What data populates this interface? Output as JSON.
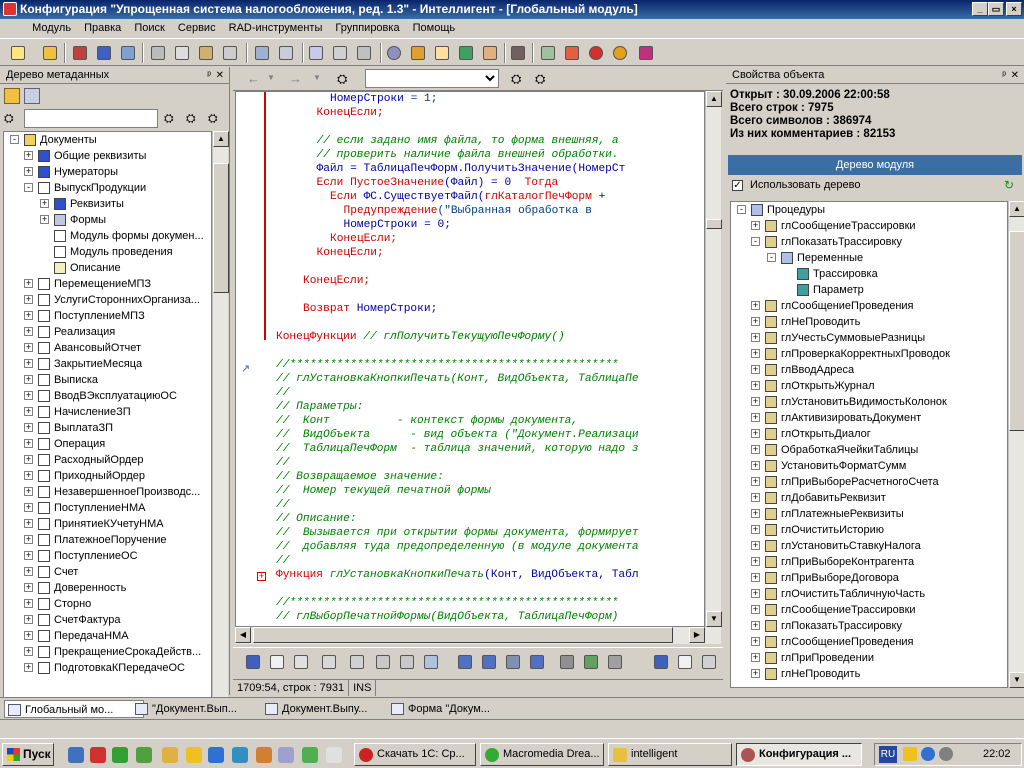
{
  "window": {
    "title": "Конфигурация \"Упрощенная система налогообложения, ред. 1.3\" - Интеллигент - [Глобальный модуль]"
  },
  "menu": [
    "Модуль",
    "Правка",
    "Поиск",
    "Сервис",
    "RAD-инструменты",
    "Группировка",
    "Помощь"
  ],
  "left_panel": {
    "title": "Дерево метаданных",
    "root": "Документы",
    "items": [
      {
        "label": "Общие реквизиты",
        "level": 1,
        "exp": "+",
        "icon": "attr"
      },
      {
        "label": "Нумераторы",
        "level": 1,
        "exp": "+",
        "icon": "attr"
      },
      {
        "label": "ВыпускПродукции",
        "level": 1,
        "exp": "-",
        "icon": "doc"
      },
      {
        "label": "Реквизиты",
        "level": 2,
        "exp": "+",
        "icon": "attr"
      },
      {
        "label": "Формы",
        "level": 2,
        "exp": "+",
        "icon": "form"
      },
      {
        "label": "Модуль формы докумен...",
        "level": 2,
        "exp": "",
        "icon": "doc"
      },
      {
        "label": "Модуль проведения",
        "level": 2,
        "exp": "",
        "icon": "doc"
      },
      {
        "label": "Описание",
        "level": 2,
        "exp": "",
        "icon": "desc"
      },
      {
        "label": "ПеремещениеМПЗ",
        "level": 1,
        "exp": "+",
        "icon": "doc"
      },
      {
        "label": "УслугиСтороннихОрганиза...",
        "level": 1,
        "exp": "+",
        "icon": "doc"
      },
      {
        "label": "ПоступлениеМПЗ",
        "level": 1,
        "exp": "+",
        "icon": "doc"
      },
      {
        "label": "Реализация",
        "level": 1,
        "exp": "+",
        "icon": "doc"
      },
      {
        "label": "АвансовыйОтчет",
        "level": 1,
        "exp": "+",
        "icon": "doc"
      },
      {
        "label": "ЗакрытиеМесяца",
        "level": 1,
        "exp": "+",
        "icon": "doc"
      },
      {
        "label": "Выписка",
        "level": 1,
        "exp": "+",
        "icon": "doc"
      },
      {
        "label": "ВводВЭксплуатациюОС",
        "level": 1,
        "exp": "+",
        "icon": "doc"
      },
      {
        "label": "НачислениеЗП",
        "level": 1,
        "exp": "+",
        "icon": "doc"
      },
      {
        "label": "ВыплатаЗП",
        "level": 1,
        "exp": "+",
        "icon": "doc"
      },
      {
        "label": "Операция",
        "level": 1,
        "exp": "+",
        "icon": "doc"
      },
      {
        "label": "РасходныйОрдер",
        "level": 1,
        "exp": "+",
        "icon": "doc"
      },
      {
        "label": "ПриходныйОрдер",
        "level": 1,
        "exp": "+",
        "icon": "doc"
      },
      {
        "label": "НезавершенноеПроизводс...",
        "level": 1,
        "exp": "+",
        "icon": "doc"
      },
      {
        "label": "ПоступлениеНМА",
        "level": 1,
        "exp": "+",
        "icon": "doc"
      },
      {
        "label": "ПринятиеКУчетуНМА",
        "level": 1,
        "exp": "+",
        "icon": "doc"
      },
      {
        "label": "ПлатежноеПоручение",
        "level": 1,
        "exp": "+",
        "icon": "doc"
      },
      {
        "label": "ПоступлениеОС",
        "level": 1,
        "exp": "+",
        "icon": "doc"
      },
      {
        "label": "Счет",
        "level": 1,
        "exp": "+",
        "icon": "doc"
      },
      {
        "label": "Доверенность",
        "level": 1,
        "exp": "+",
        "icon": "doc"
      },
      {
        "label": "Сторно",
        "level": 1,
        "exp": "+",
        "icon": "doc"
      },
      {
        "label": "СчетФактура",
        "level": 1,
        "exp": "+",
        "icon": "doc"
      },
      {
        "label": "ПередачаНМА",
        "level": 1,
        "exp": "+",
        "icon": "doc"
      },
      {
        "label": "ПрекращениеСрокаДейств...",
        "level": 1,
        "exp": "+",
        "icon": "doc"
      },
      {
        "label": "ПодготовкаКПередачеОС",
        "level": 1,
        "exp": "+",
        "icon": "doc"
      }
    ]
  },
  "code_lines": [
    {
      "ind": 8,
      "parts": [
        [
          "id",
          "НомерСтроки"
        ],
        [
          "st",
          " = 1;"
        ]
      ]
    },
    {
      "ind": 6,
      "parts": [
        [
          "kw",
          "КонецЕсли;"
        ]
      ]
    },
    {
      "ind": 0,
      "parts": []
    },
    {
      "ind": 6,
      "parts": [
        [
          "cm",
          "// если задано имя файла, то форма внешняя, а"
        ]
      ]
    },
    {
      "ind": 6,
      "parts": [
        [
          "cm",
          "// проверить наличие файла внешней обработки."
        ]
      ]
    },
    {
      "ind": 6,
      "parts": [
        [
          "id",
          "Файл = ТаблицаПечФорм.ПолучитьЗначение(НомерСт"
        ]
      ]
    },
    {
      "ind": 6,
      "parts": [
        [
          "kw",
          "Если ПустоеЗначение"
        ],
        [
          "id",
          "(Файл) = 0  "
        ],
        [
          "kw",
          "Тогда"
        ]
      ]
    },
    {
      "ind": 8,
      "parts": [
        [
          "kw",
          "Если "
        ],
        [
          "id",
          "ФС.СуществуетФайл("
        ],
        [
          "kw",
          "глКаталогПечФорм"
        ],
        [
          "id",
          " +"
        ]
      ]
    },
    {
      "ind": 10,
      "parts": [
        [
          "kw",
          "Предупреждение"
        ],
        [
          "st",
          "(\"Выбранная обработка в"
        ]
      ]
    },
    {
      "ind": 10,
      "parts": [
        [
          "id",
          "НомерСтроки = 0;"
        ]
      ]
    },
    {
      "ind": 8,
      "parts": [
        [
          "kw",
          "КонецЕсли;"
        ]
      ]
    },
    {
      "ind": 6,
      "parts": [
        [
          "kw",
          "КонецЕсли;"
        ]
      ]
    },
    {
      "ind": 0,
      "parts": []
    },
    {
      "ind": 4,
      "parts": [
        [
          "kw",
          "КонецЕсли;"
        ]
      ]
    },
    {
      "ind": 0,
      "parts": []
    },
    {
      "ind": 4,
      "parts": [
        [
          "kw",
          "Возврат "
        ],
        [
          "id",
          "НомерСтроки;"
        ]
      ]
    },
    {
      "ind": 0,
      "parts": []
    },
    {
      "ind": 0,
      "parts": [
        [
          "kw",
          "КонецФункции "
        ],
        [
          "cm",
          "// глПолучитьТекущуюПечФорму()"
        ]
      ]
    },
    {
      "ind": 0,
      "parts": []
    },
    {
      "ind": 0,
      "parts": [
        [
          "cm",
          "//*************************************************"
        ]
      ]
    },
    {
      "ind": 0,
      "parts": [
        [
          "cm",
          "// глУстановкаКнопкиПечать(Конт, ВидОбъекта, ТаблицаПе"
        ]
      ]
    },
    {
      "ind": 0,
      "parts": [
        [
          "cm",
          "//"
        ]
      ]
    },
    {
      "ind": 0,
      "parts": [
        [
          "cm",
          "// Параметры:"
        ]
      ]
    },
    {
      "ind": 0,
      "parts": [
        [
          "cm",
          "//  Конт          - контекст формы документа,"
        ]
      ]
    },
    {
      "ind": 0,
      "parts": [
        [
          "cm",
          "//  ВидОбъекта      - вид объекта (\"Документ.Реализаци"
        ]
      ]
    },
    {
      "ind": 0,
      "parts": [
        [
          "cm",
          "//  ТаблицаПечФорм  - таблица значений, которую надо з"
        ]
      ]
    },
    {
      "ind": 0,
      "parts": [
        [
          "cm",
          "//"
        ]
      ]
    },
    {
      "ind": 0,
      "parts": [
        [
          "cm",
          "// Возвращаемое значение:"
        ]
      ]
    },
    {
      "ind": 0,
      "parts": [
        [
          "cm",
          "//  Номер текущей печатной формы"
        ]
      ]
    },
    {
      "ind": 0,
      "parts": [
        [
          "cm",
          "//"
        ]
      ]
    },
    {
      "ind": 0,
      "parts": [
        [
          "cm",
          "// Описание:"
        ]
      ]
    },
    {
      "ind": 0,
      "parts": [
        [
          "cm",
          "//  Вызывается при открытии формы документа, формирует"
        ]
      ]
    },
    {
      "ind": 0,
      "parts": [
        [
          "cm",
          "//  добавляя туда предопределенную (в модуле документа"
        ]
      ]
    },
    {
      "ind": 0,
      "parts": [
        [
          "cm",
          "//"
        ]
      ]
    },
    {
      "ind": 0,
      "parts": [
        [
          "kw",
          "Функция "
        ],
        [
          "cm",
          "глУстановкаКнопкиПечать"
        ],
        [
          "id",
          "(Конт, ВидОбъекта, Табл"
        ]
      ]
    },
    {
      "ind": 0,
      "parts": []
    },
    {
      "ind": 0,
      "parts": [
        [
          "cm",
          "//*************************************************"
        ]
      ]
    },
    {
      "ind": 0,
      "parts": [
        [
          "cm",
          "// глВыборПечатнойФормы(ВидОбъекта, ТаблицаПечФорм)"
        ]
      ]
    }
  ],
  "status": {
    "position": "1709:54, строк : 7931",
    "mode": "INS"
  },
  "right_panel": {
    "title": "Свойства объекта",
    "stats": [
      "Открыт : 30.09.2006 22:00:58",
      "Всего строк : 7975",
      "Всего символов : 386974",
      "Из них комментариев : 82153"
    ],
    "module_tree_label": "Дерево модуля",
    "use_tree_label": "Использовать дерево",
    "root": "Процедуры",
    "items": [
      {
        "label": "глСообщениеТрассировки",
        "level": 1,
        "exp": "+"
      },
      {
        "label": "глПоказатьТрассировку",
        "level": 1,
        "exp": "-"
      },
      {
        "label": "Переменные",
        "level": 2,
        "exp": "-"
      },
      {
        "label": "Трассировка",
        "level": 3,
        "exp": ""
      },
      {
        "label": "Параметр",
        "level": 3,
        "exp": ""
      },
      {
        "label": "глСообщениеПроведения",
        "level": 1,
        "exp": "+"
      },
      {
        "label": "глНеПроводить",
        "level": 1,
        "exp": "+"
      },
      {
        "label": "глУчестьСуммовыеРазницы",
        "level": 1,
        "exp": "+"
      },
      {
        "label": "глПроверкаКорректныхПроводок",
        "level": 1,
        "exp": "+"
      },
      {
        "label": "глВводАдреса",
        "level": 1,
        "exp": "+"
      },
      {
        "label": "глОткрытьЖурнал",
        "level": 1,
        "exp": "+"
      },
      {
        "label": "глУстановитьВидимостьКолонок",
        "level": 1,
        "exp": "+"
      },
      {
        "label": "глАктивизироватьДокумент",
        "level": 1,
        "exp": "+"
      },
      {
        "label": "глОткрытьДиалог",
        "level": 1,
        "exp": "+"
      },
      {
        "label": "ОбработкаЯчейкиТаблицы",
        "level": 1,
        "exp": "+"
      },
      {
        "label": "УстановитьФорматСумм",
        "level": 1,
        "exp": "+"
      },
      {
        "label": "глПриВыбореРасчетногоСчета",
        "level": 1,
        "exp": "+"
      },
      {
        "label": "глДобавитьРеквизит",
        "level": 1,
        "exp": "+"
      },
      {
        "label": "глПлатежныеРеквизиты",
        "level": 1,
        "exp": "+"
      },
      {
        "label": "глОчиститьИсторию",
        "level": 1,
        "exp": "+"
      },
      {
        "label": "глУстановитьСтавкуНалога",
        "level": 1,
        "exp": "+"
      },
      {
        "label": "глПриВыбореКонтрагента",
        "level": 1,
        "exp": "+"
      },
      {
        "label": "глПриВыбореДоговора",
        "level": 1,
        "exp": "+"
      },
      {
        "label": "глОчиститьТабличнуюЧасть",
        "level": 1,
        "exp": "+"
      },
      {
        "label": "глСообщениеТрассировки",
        "level": 1,
        "exp": "+"
      },
      {
        "label": "глПоказатьТрассировку",
        "level": 1,
        "exp": "+"
      },
      {
        "label": "глСообщениеПроведения",
        "level": 1,
        "exp": "+"
      },
      {
        "label": "глПриПроведении",
        "level": 1,
        "exp": "+"
      },
      {
        "label": "глНеПроводить",
        "level": 1,
        "exp": "+"
      }
    ]
  },
  "window_tabs": [
    "Глобальный мо...",
    "\"Документ.Вып...",
    "Документ.Выпу...",
    "Форма \"Докум..."
  ],
  "taskbar": {
    "start": "Пуск",
    "tasks": [
      {
        "label": "Скачать 1С: Ср...",
        "color": "#c22"
      },
      {
        "label": "Macromedia Drea...",
        "color": "#3a3"
      },
      {
        "label": "intelligent",
        "color": "#e8c040"
      },
      {
        "label": "Конфигурация ...",
        "color": "#a55"
      }
    ],
    "lang": "RU",
    "clock": "22:02"
  }
}
